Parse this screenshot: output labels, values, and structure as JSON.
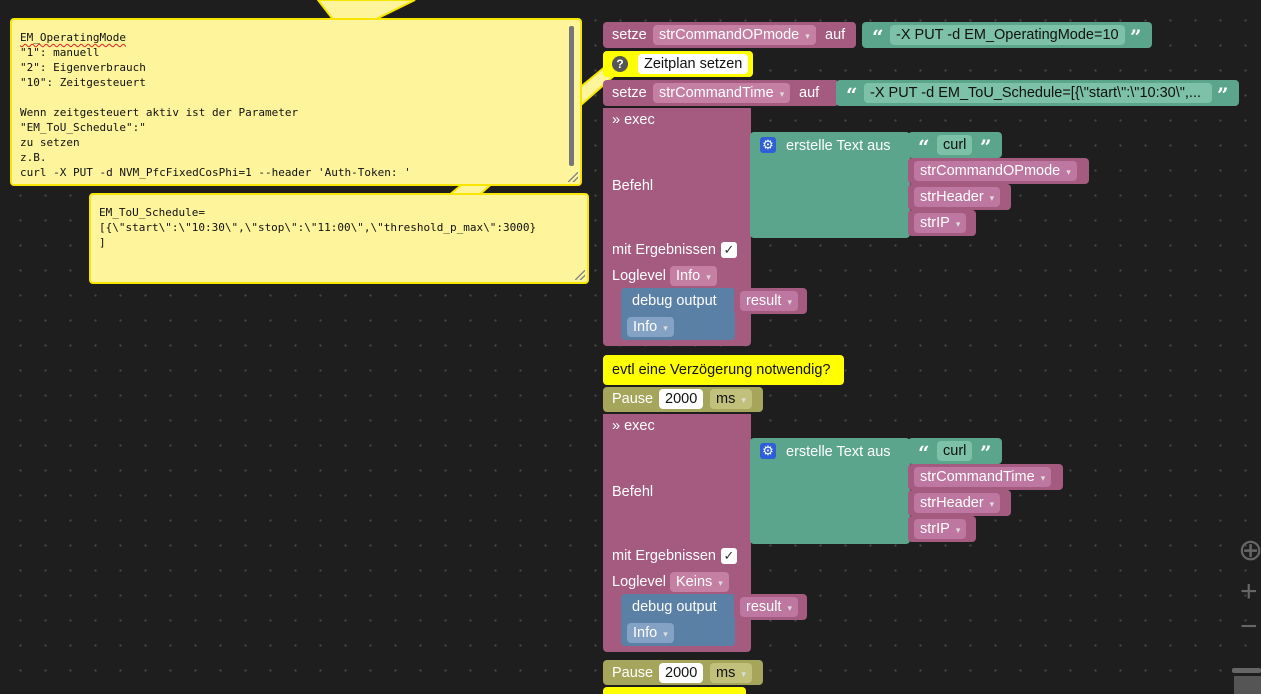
{
  "comment1": {
    "lines": [
      "EM_OperatingMode",
      "\"1\": manuell",
      "\"2\": Eigenverbrauch",
      "\"10\": Zeitgesteuert",
      "",
      "Wenn zeitgesteuert aktiv ist der Parameter",
      "\"EM_ToU_Schedule\":\"",
      "zu setzen",
      "z.B.",
      "curl -X PUT -d NVM_PfcFixedCosPhi=1 --header 'Auth-Token: '"
    ]
  },
  "comment2": {
    "lines": [
      "EM_ToU_Schedule=",
      "[{\\\"start\\\":\\\"10:30\\\",\\\"stop\\\":\\\"11:00\\\",\\\"threshold_p_max\\\":3000}",
      "]"
    ]
  },
  "blocks": {
    "set1": {
      "keyword": "setze",
      "variable": "strCommandOPmode",
      "to": "auf",
      "value": "-X PUT -d EM_OperatingMode=10"
    },
    "note1": {
      "text": "Zeitplan setzen"
    },
    "set2": {
      "keyword": "setze",
      "variable": "strCommandTime",
      "to": "auf",
      "value": "-X PUT -d EM_ToU_Schedule=[{\\\"start\\\":\\\"10:30\\\",..."
    },
    "exec1": {
      "title": "» exec",
      "command_label": "Befehl",
      "text_join_label": "erstelle Text aus",
      "items": [
        "curl",
        "strCommandOPmode",
        "strHeader",
        "strIP"
      ],
      "results_label": "mit Ergebnissen",
      "loglevel_label": "Loglevel",
      "loglevel_value": "Info",
      "debug_label": "debug output",
      "debug_var": "result",
      "debug_level": "Info"
    },
    "note2": {
      "text": "evtl eine Verzögerung notwendig?"
    },
    "pause1": {
      "label": "Pause",
      "value": "2000",
      "unit": "ms"
    },
    "exec2": {
      "title": "» exec",
      "command_label": "Befehl",
      "text_join_label": "erstelle Text aus",
      "items": [
        "curl",
        "strCommandTime",
        "strHeader",
        "strIP"
      ],
      "results_label": "mit Ergebnissen",
      "loglevel_label": "Loglevel",
      "loglevel_value": "Keins",
      "debug_label": "debug output",
      "debug_var": "result",
      "debug_level": "Info"
    },
    "pause2": {
      "label": "Pause",
      "value": "2000",
      "unit": "ms"
    }
  },
  "icons": {
    "dropdown": "▾",
    "check": "✓",
    "question": "?",
    "gear": "⚙",
    "quote_open": "“",
    "quote_close": "”",
    "center": "⊕",
    "zoom_in": "+",
    "zoom_out": "−"
  }
}
